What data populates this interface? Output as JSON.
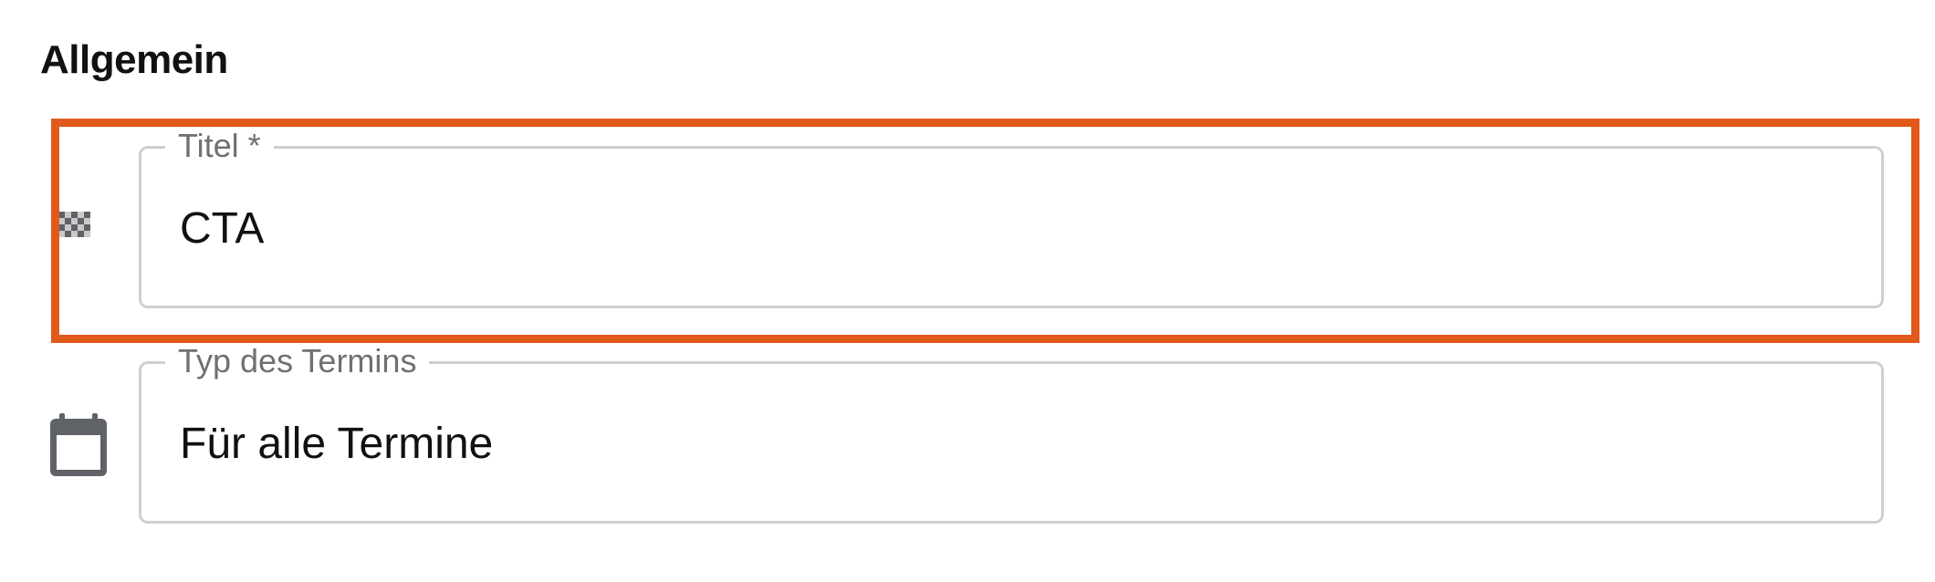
{
  "section": {
    "title": "Allgemein"
  },
  "fields": {
    "title_field": {
      "label": "Titel *",
      "value": "CTA",
      "icon": "checkered-flag-icon"
    },
    "event_type_field": {
      "label": "Typ des Termins",
      "value": "Für alle Termine",
      "icon": "calendar-icon"
    }
  },
  "colors": {
    "highlight": "#e05a1c",
    "border": "#cfcfcf",
    "label": "#707070",
    "icon": "#5f6368"
  }
}
